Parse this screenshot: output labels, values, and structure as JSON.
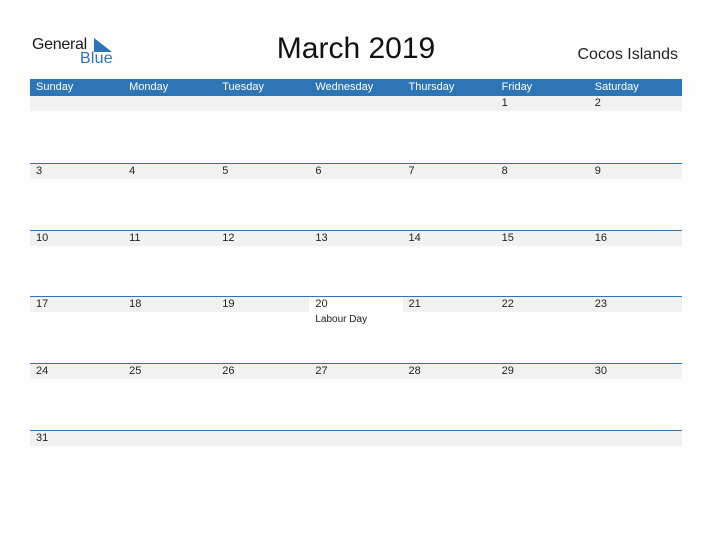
{
  "logo": {
    "word1": "General",
    "word2": "Blue"
  },
  "title": "March 2019",
  "region": "Cocos Islands",
  "colors": {
    "accent": "#2e75b6",
    "strip": "#f1f1f1"
  },
  "weekdays": [
    "Sunday",
    "Monday",
    "Tuesday",
    "Wednesday",
    "Thursday",
    "Friday",
    "Saturday"
  ],
  "weeks": [
    [
      {
        "d": ""
      },
      {
        "d": ""
      },
      {
        "d": ""
      },
      {
        "d": ""
      },
      {
        "d": ""
      },
      {
        "d": "1"
      },
      {
        "d": "2"
      }
    ],
    [
      {
        "d": "3"
      },
      {
        "d": "4"
      },
      {
        "d": "5"
      },
      {
        "d": "6"
      },
      {
        "d": "7"
      },
      {
        "d": "8"
      },
      {
        "d": "9"
      }
    ],
    [
      {
        "d": "10"
      },
      {
        "d": "11"
      },
      {
        "d": "12"
      },
      {
        "d": "13"
      },
      {
        "d": "14"
      },
      {
        "d": "15"
      },
      {
        "d": "16"
      }
    ],
    [
      {
        "d": "17"
      },
      {
        "d": "18"
      },
      {
        "d": "19"
      },
      {
        "d": "20",
        "holiday": "Labour Day"
      },
      {
        "d": "21"
      },
      {
        "d": "22"
      },
      {
        "d": "23"
      }
    ],
    [
      {
        "d": "24"
      },
      {
        "d": "25"
      },
      {
        "d": "26"
      },
      {
        "d": "27"
      },
      {
        "d": "28"
      },
      {
        "d": "29"
      },
      {
        "d": "30"
      }
    ],
    [
      {
        "d": "31"
      }
    ]
  ]
}
